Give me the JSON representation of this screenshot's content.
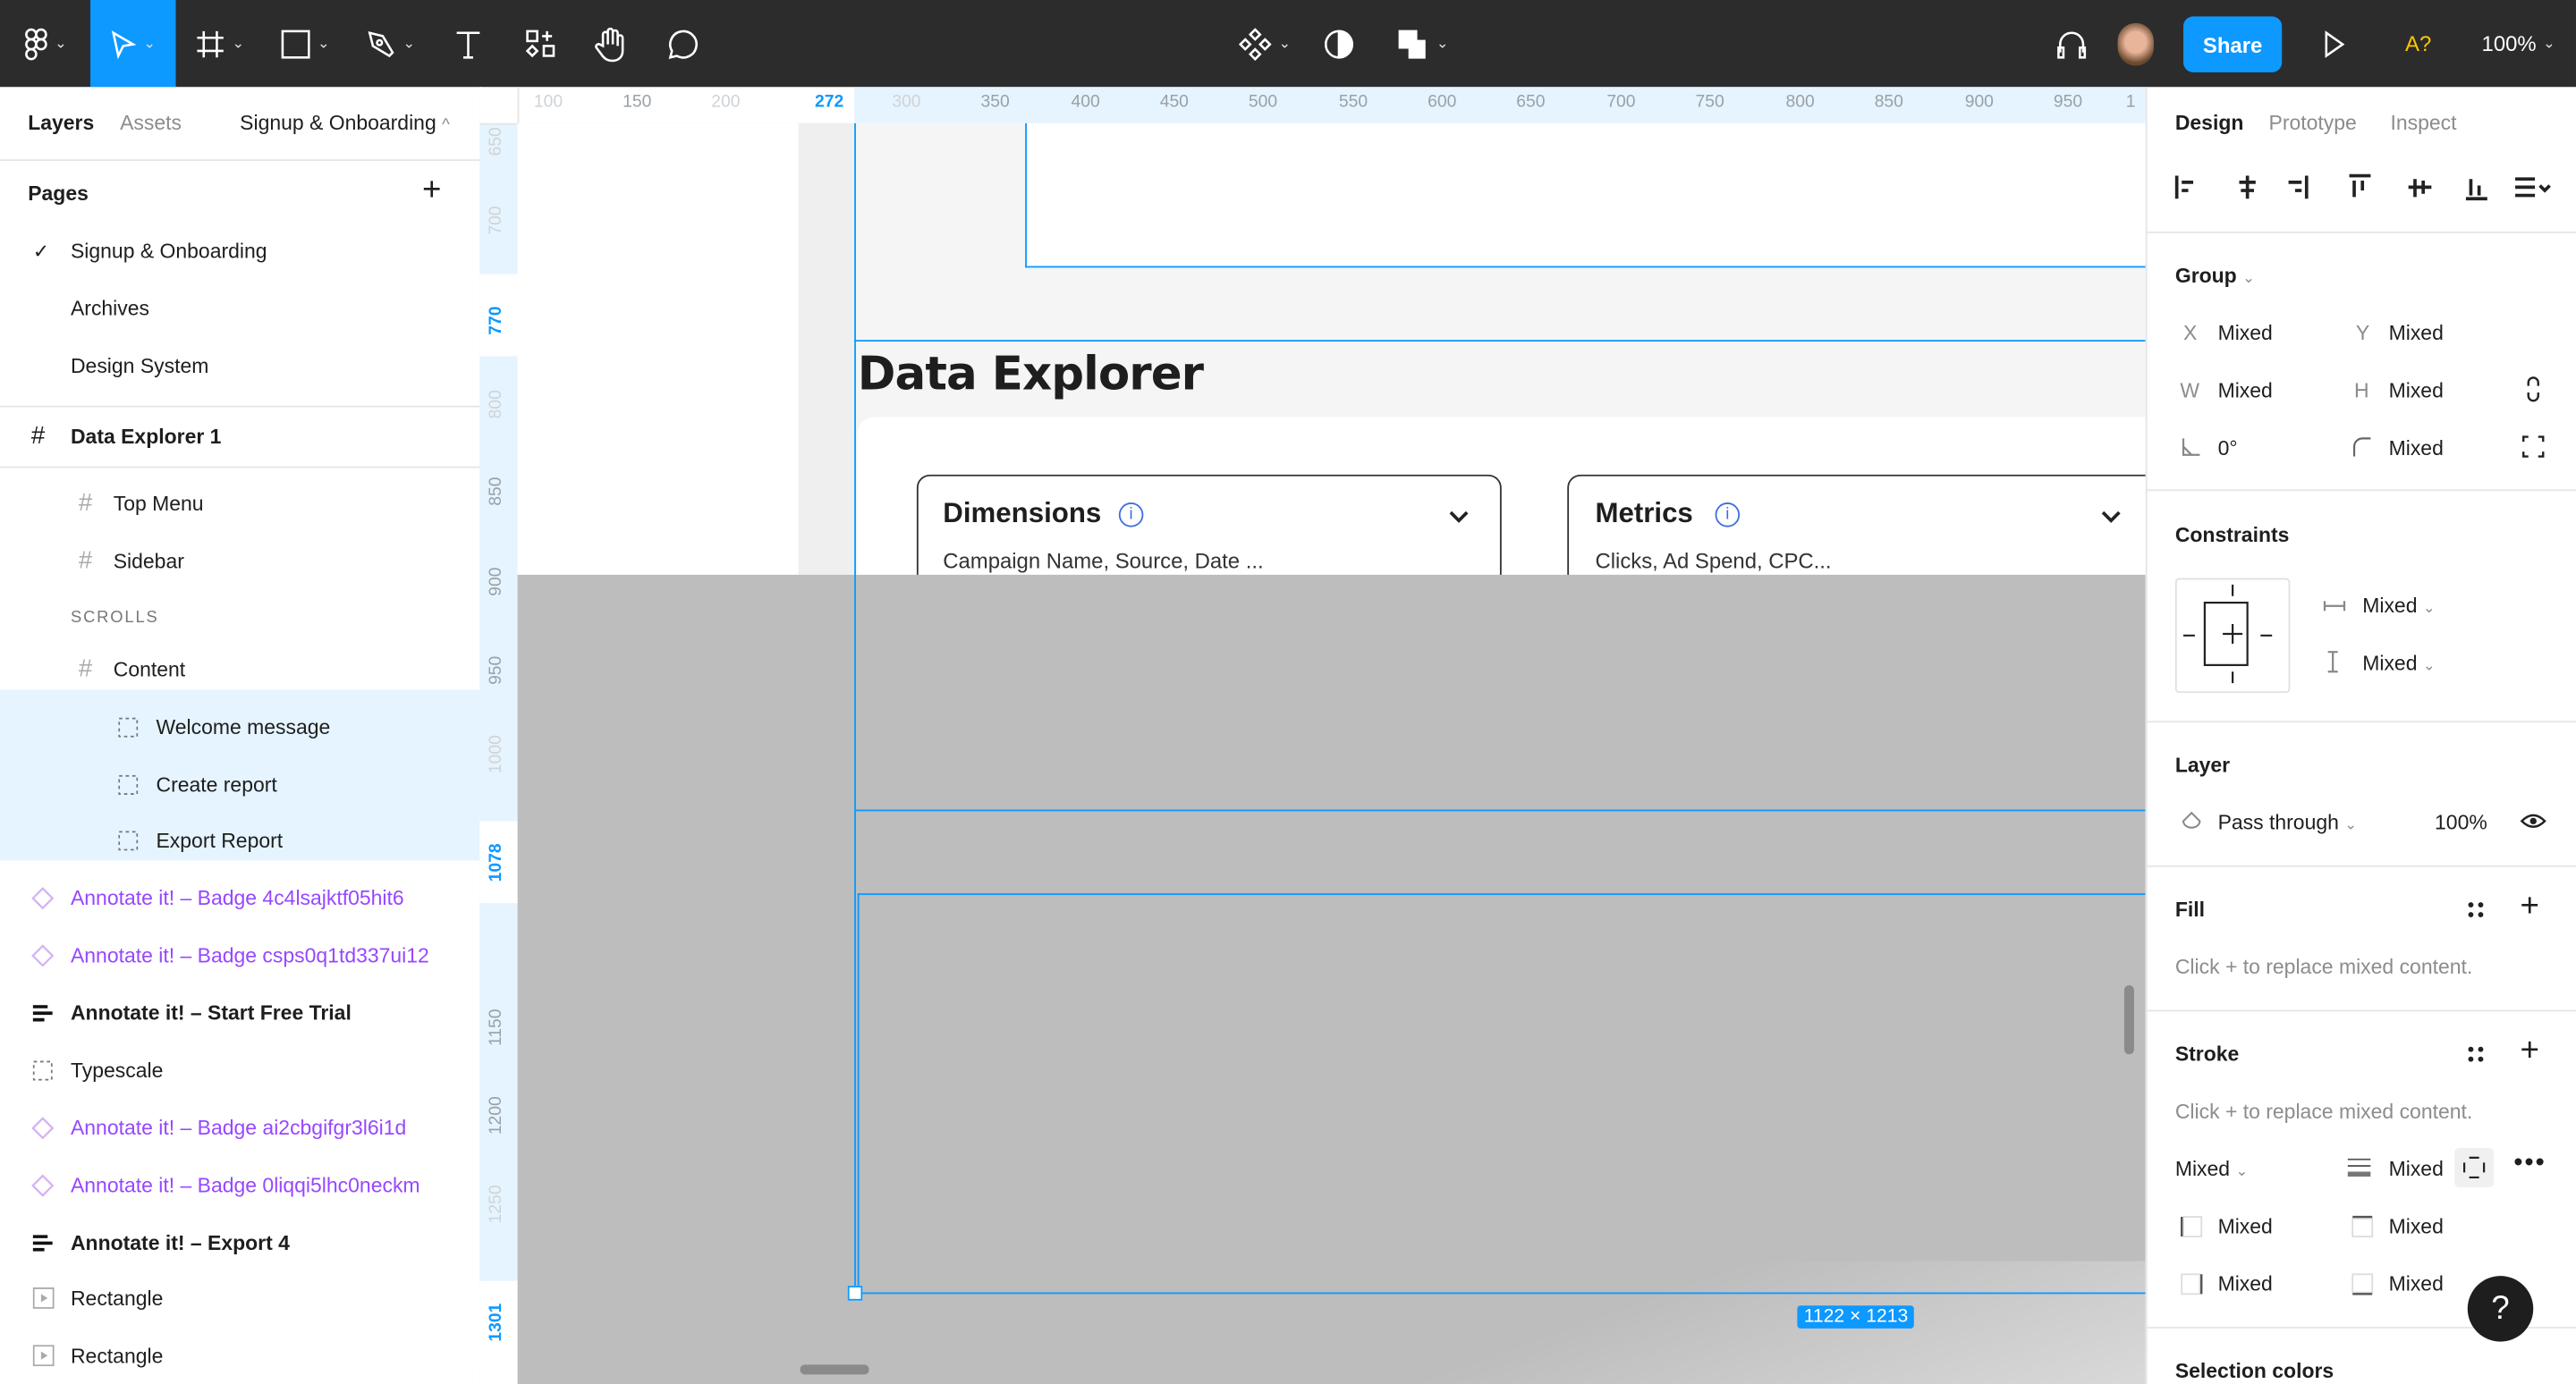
{
  "toolbar": {
    "tools": [
      "main-menu",
      "move",
      "frame",
      "shape",
      "pen",
      "text",
      "resources",
      "hand",
      "comment"
    ],
    "center_tools": [
      "components",
      "mask",
      "boolean"
    ],
    "share_label": "Share",
    "font_warning": "A?",
    "zoom": "100%",
    "accent": "#0d99ff"
  },
  "left_panel": {
    "tabs": [
      "Layers",
      "Assets"
    ],
    "page_selector": "Signup & Onboarding",
    "pages_title": "Pages",
    "pages": [
      "Signup & Onboarding",
      "Archives",
      "Design System"
    ],
    "current_page": "Signup & Onboarding",
    "frame": "Data Explorer 1",
    "layers": [
      {
        "label": "Top Menu",
        "icon": "frame"
      },
      {
        "label": "Sidebar",
        "icon": "frame"
      },
      {
        "label": "SCROLLS",
        "icon": "none"
      },
      {
        "label": "Content",
        "icon": "frame"
      },
      {
        "label": "Welcome message",
        "icon": "group"
      },
      {
        "label": "Create report",
        "icon": "group"
      },
      {
        "label": "Export Report",
        "icon": "group"
      },
      {
        "label": "Annotate it! – Badge 4c4lsajktf05hit6",
        "icon": "instance"
      },
      {
        "label": "Annotate it! – Badge csps0q1td337ui12",
        "icon": "instance"
      },
      {
        "label": "Annotate it! – Start Free Trial",
        "icon": "text-lines"
      },
      {
        "label": "Typescale",
        "icon": "group"
      },
      {
        "label": "Annotate it! – Badge ai2cbgifgr3l6i1d",
        "icon": "instance"
      },
      {
        "label": "Annotate it! – Badge 0liqqi5lhc0neckm",
        "icon": "instance"
      },
      {
        "label": "Annotate it! – Export 4",
        "icon": "text-lines"
      },
      {
        "label": "Rectangle",
        "icon": "image"
      },
      {
        "label": "Rectangle",
        "icon": "image"
      }
    ],
    "badge_color": "#9747ff"
  },
  "rulers": {
    "horizontal": [
      {
        "v": "100",
        "s": "faint"
      },
      {
        "v": "150",
        "s": ""
      },
      {
        "v": "200",
        "s": "faint"
      },
      {
        "v": "272",
        "s": "active"
      },
      {
        "v": "300",
        "s": "faint"
      },
      {
        "v": "350",
        "s": ""
      },
      {
        "v": "400",
        "s": ""
      },
      {
        "v": "450",
        "s": ""
      },
      {
        "v": "500",
        "s": ""
      },
      {
        "v": "550",
        "s": ""
      },
      {
        "v": "600",
        "s": ""
      },
      {
        "v": "650",
        "s": ""
      },
      {
        "v": "700",
        "s": ""
      },
      {
        "v": "750",
        "s": ""
      },
      {
        "v": "800",
        "s": ""
      },
      {
        "v": "850",
        "s": ""
      },
      {
        "v": "900",
        "s": ""
      },
      {
        "v": "950",
        "s": ""
      },
      {
        "v": "1",
        "s": ""
      }
    ],
    "vertical": [
      {
        "v": "650",
        "s": "faint"
      },
      {
        "v": "700",
        "s": "faint"
      },
      {
        "v": "770",
        "s": "active"
      },
      {
        "v": "800",
        "s": "faint"
      },
      {
        "v": "850",
        "s": ""
      },
      {
        "v": "900",
        "s": ""
      },
      {
        "v": "950",
        "s": ""
      },
      {
        "v": "1000",
        "s": "faint"
      },
      {
        "v": "1078",
        "s": "active"
      },
      {
        "v": "1150",
        "s": ""
      },
      {
        "v": "1200",
        "s": ""
      },
      {
        "v": "1250",
        "s": "faint"
      },
      {
        "v": "1301",
        "s": "active"
      }
    ]
  },
  "canvas": {
    "frame_title": "Data Explorer",
    "dimensions": {
      "title": "Dimensions",
      "value": "Campaign Name, Source, Date ..."
    },
    "metrics": {
      "title": "Metrics",
      "value": "Clicks, Ad Spend, CPC..."
    },
    "selection_size": "1122 × 1213",
    "selection_color": "#0d99ff"
  },
  "right_panel": {
    "tabs": [
      "Design",
      "Prototype",
      "Inspect"
    ],
    "group": {
      "title": "Group",
      "x_label": "X",
      "x": "Mixed",
      "y_label": "Y",
      "y": "Mixed",
      "w_label": "W",
      "w": "Mixed",
      "h_label": "H",
      "h": "Mixed",
      "rotation": "0°",
      "radius": "Mixed"
    },
    "constraints": {
      "title": "Constraints",
      "horizontal": "Mixed",
      "vertical": "Mixed"
    },
    "layer": {
      "title": "Layer",
      "blend": "Pass through",
      "opacity": "100%"
    },
    "fill": {
      "title": "Fill",
      "hint": "Click + to replace mixed content."
    },
    "stroke": {
      "title": "Stroke",
      "hint": "Click + to replace mixed content.",
      "style": "Mixed",
      "weight": "Mixed",
      "left": "Mixed",
      "top": "Mixed",
      "right": "Mixed",
      "bottom": "Mixed"
    },
    "selection_colors": "Selection colors",
    "help": "?"
  }
}
